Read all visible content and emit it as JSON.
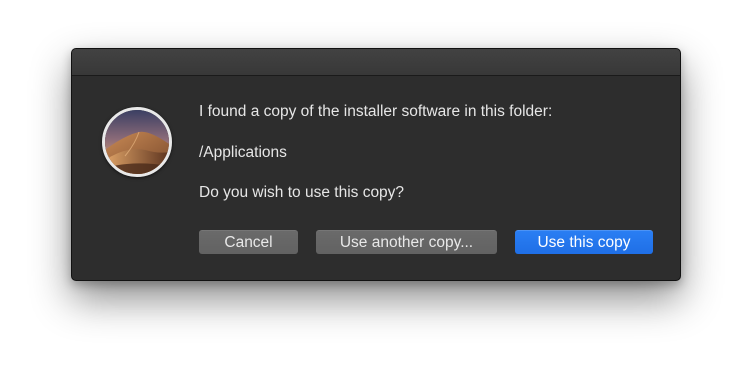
{
  "dialog": {
    "message_line1": "I found a copy of the installer software in this folder:",
    "folder_path": "/Applications",
    "question": "Do you wish to use this copy?",
    "icon": "macos-mojave-installer-icon"
  },
  "buttons": {
    "cancel_label": "Cancel",
    "other_label": "Use another copy...",
    "primary_label": "Use this copy"
  },
  "colors": {
    "dialog_background": "#2d2d2d",
    "primary_button": "#2375ec",
    "secondary_button": "#656565",
    "text": "#e6e6e6"
  }
}
